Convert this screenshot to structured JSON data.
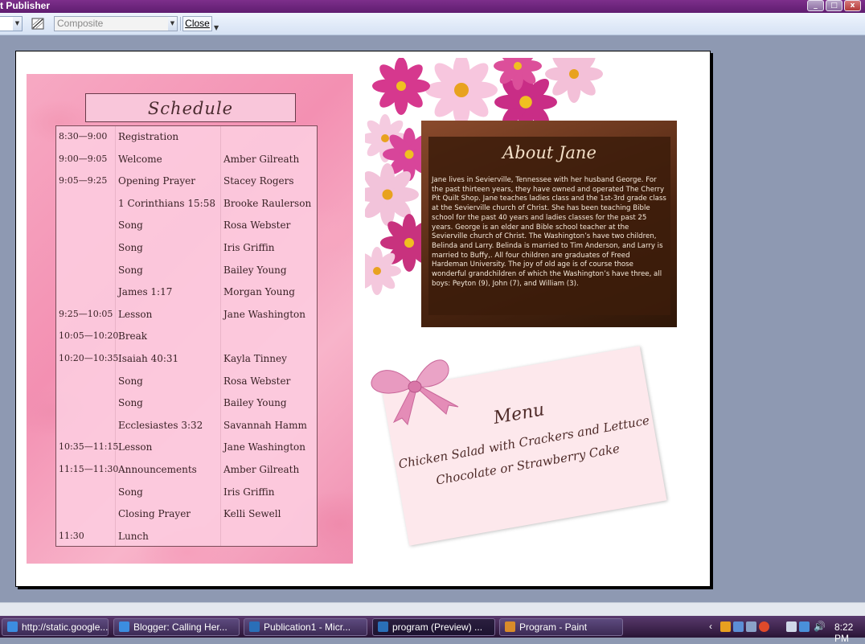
{
  "window": {
    "title": "t Publisher"
  },
  "toolbar": {
    "color_mode": "Composite",
    "close_label": "Close"
  },
  "schedule": {
    "title": "Schedule",
    "rows": [
      {
        "time": "8:30—9:00",
        "item": "Registration",
        "name": ""
      },
      {
        "time": "9:00—9:05",
        "item": "Welcome",
        "name": "Amber Gilreath"
      },
      {
        "time": "9:05—9:25",
        "item": "Opening Prayer",
        "name": "Stacey Rogers"
      },
      {
        "time": "",
        "item": "1 Corinthians  15:58",
        "name": "Brooke Raulerson"
      },
      {
        "time": "",
        "item": "Song",
        "name": "Rosa Webster"
      },
      {
        "time": "",
        "item": "Song",
        "name": "Iris Griffin"
      },
      {
        "time": "",
        "item": "Song",
        "name": "Bailey Young"
      },
      {
        "time": "",
        "item": "James 1:17",
        "name": "Morgan Young"
      },
      {
        "time": "9:25—10:05",
        "item": "Lesson",
        "name": "Jane Washington"
      },
      {
        "time": "10:05—10:20",
        "item": "Break",
        "name": ""
      },
      {
        "time": "10:20—10:35",
        "item": "Isaiah 40:31",
        "name": "Kayla Tinney"
      },
      {
        "time": "",
        "item": "Song",
        "name": "Rosa Webster"
      },
      {
        "time": "",
        "item": "Song",
        "name": "Bailey Young"
      },
      {
        "time": "",
        "item": "Ecclesiastes 3:32",
        "name": "Savannah Hamm"
      },
      {
        "time": "10:35—11:15",
        "item": "Lesson",
        "name": "Jane Washington"
      },
      {
        "time": "11:15—11:30",
        "item": "Announcements",
        "name": "Amber Gilreath"
      },
      {
        "time": "",
        "item": "Song",
        "name": "Iris Griffin"
      },
      {
        "time": "",
        "item": "Closing Prayer",
        "name": "Kelli Sewell"
      },
      {
        "time": "11:30",
        "item": "Lunch",
        "name": ""
      }
    ]
  },
  "about": {
    "title": "About  Jane",
    "text": "Jane lives in Sevierville, Tennessee with her husband George. For the past thirteen years, they have owned and operated The Cherry Pit Quilt Shop. Jane teaches ladies class and the 1st-3rd grade class at the Sevierville church of Christ. She has been teaching Bible school for the past 40 years and ladies classes for the past 25 years. George is an elder and Bible school teacher at the Sevierville church of Christ.  The Washington’s have two children, Belinda and Larry. Belinda is married to Tim Anderson, and Larry is married to Buffy,. All four children are graduates of Freed Hardeman University. The joy of old age is of course those wonderful grandchildren of which the Washington’s have three, all boys: Peyton (9), John (7), and William (3)."
  },
  "menu": {
    "title": "Menu",
    "line1": "Chicken Salad with Crackers and Lettuce",
    "line2": "Chocolate or Strawberry Cake"
  },
  "taskbar": {
    "tasks": [
      {
        "label": "http://static.google...",
        "icon": "ie-icon"
      },
      {
        "label": "Blogger: Calling Her...",
        "icon": "ie-icon"
      },
      {
        "label": "Publication1 - Micr...",
        "icon": "publisher-icon"
      },
      {
        "label": "program (Preview) ...",
        "icon": "publisher-icon"
      },
      {
        "label": "Program - Paint",
        "icon": "paint-icon"
      }
    ],
    "clock": "8:22 PM"
  }
}
